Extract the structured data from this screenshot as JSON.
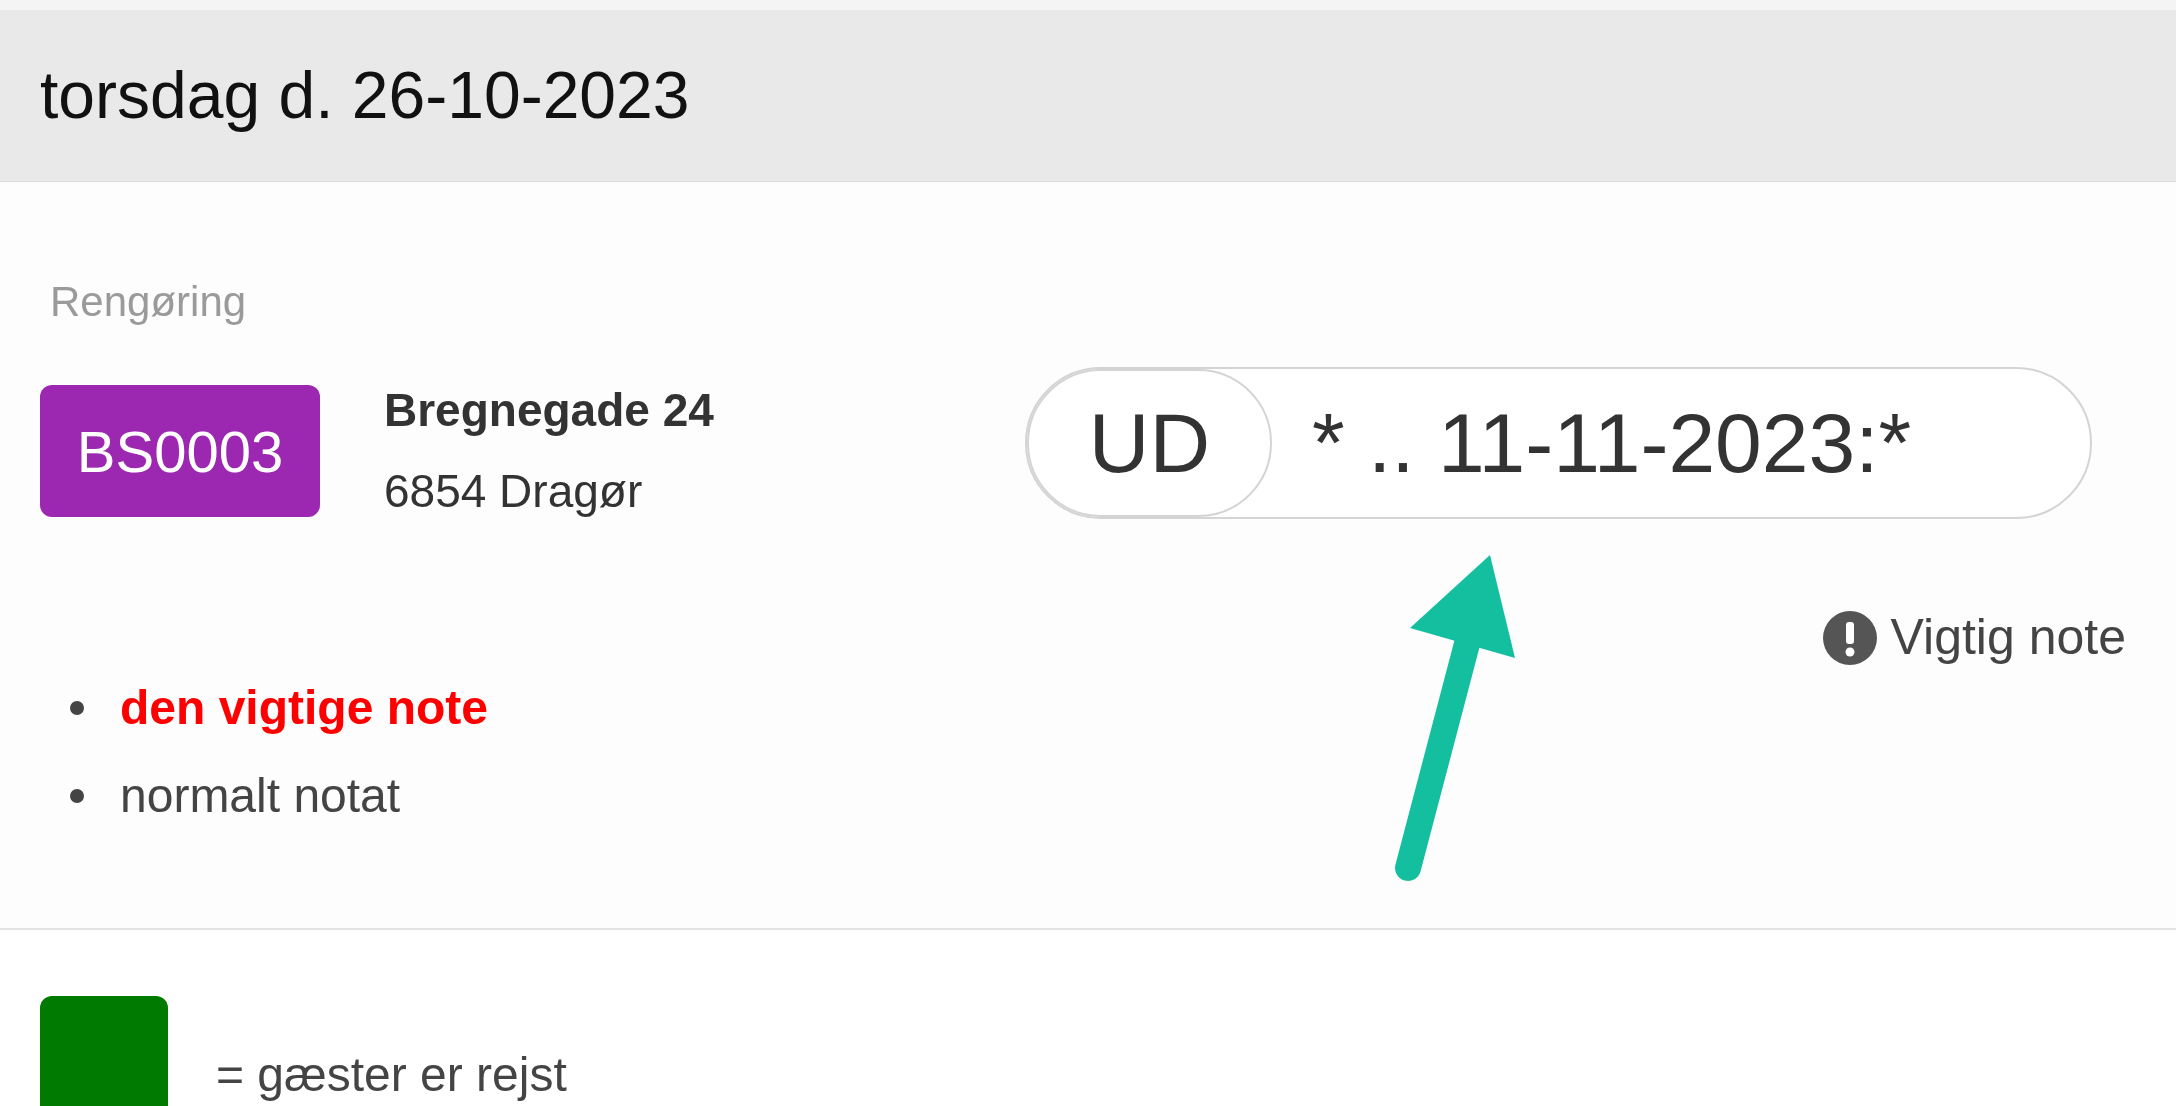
{
  "header": {
    "date": "torsdag d. 26-10-2023"
  },
  "booking": {
    "category": "Rengøring",
    "code": "BS0003",
    "street": "Bregnegade 24",
    "city": "6854 Dragør",
    "status": {
      "label": "UD",
      "text": "* .. 11-11-2023:*"
    },
    "important_label": "Vigtig note",
    "notes": [
      {
        "text": "den vigtige note",
        "important": true
      },
      {
        "text": "normalt notat",
        "important": false
      }
    ]
  },
  "legend": [
    {
      "color": "#007a00",
      "text": "= gæster er rejst"
    }
  ]
}
